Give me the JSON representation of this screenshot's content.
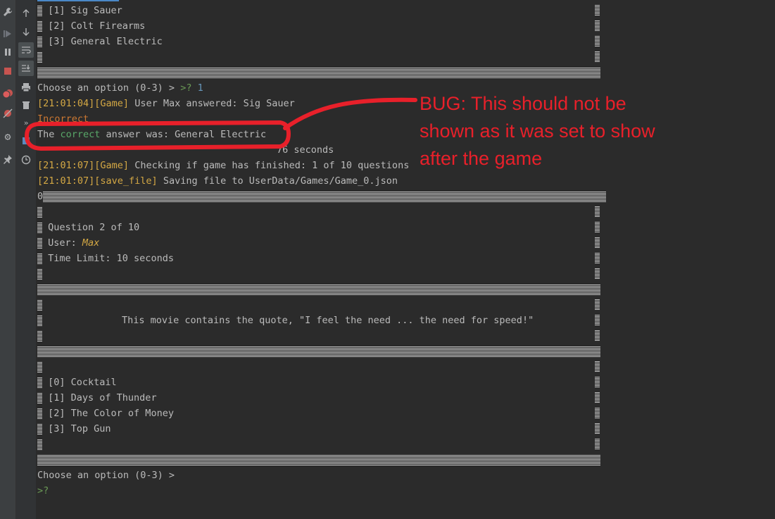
{
  "console": {
    "options_prev": [
      "[1] Sig Sauer",
      "[2] Colt Firearms",
      "[3] General Electric"
    ],
    "prompt": "Choose an option (0-3) > ",
    "input_marker": ">?",
    "input_value": " 1",
    "log1": {
      "ts": "[21:01:04]",
      "tag": "[Game]",
      "msg": " User Max answered: Sig Sauer"
    },
    "incorrect": "Incorrect",
    "correct_line": {
      "pre": "The ",
      "word": "correct",
      "post": " answer was: General Electric"
    },
    "time_line_suffix": "76 seconds",
    "log2": {
      "ts": "[21:01:07]",
      "tag": "[Game]",
      "msg": " Checking if game has finished: 1 of 10 questions"
    },
    "log3": {
      "ts": "[21:01:07]",
      "tag": "[save_file]",
      "msg": " Saving file to UserData/Games/Game_0.json"
    },
    "zero_marker": "0",
    "question_header": "Question 2 of 10",
    "user_label": "User: ",
    "user_name": "Max",
    "time_limit": "Time Limit: 10 seconds",
    "question_text": "This movie contains the quote, \"I feel the need ... the need for speed!\"",
    "options": [
      "[0] Cocktail",
      "[1] Days of Thunder",
      "[2] The Color of Money",
      "[3] Top Gun"
    ],
    "prompt2": "Choose an option (0-3) > ",
    "input_marker2": ">?"
  },
  "annotation": {
    "text_lines": [
      "BUG: This should not be",
      "shown as it was set to show",
      "after the game"
    ],
    "color": "#e8202a"
  },
  "icons": {
    "left_gutter": [
      "wrench-icon",
      "rerun-icon",
      "pause-icon",
      "stop-icon",
      "breakpoints-icon",
      "mute-breakpoints-icon",
      "settings-icon",
      "pin-icon"
    ],
    "tool_column": [
      "up-arrow-icon",
      "down-arrow-icon",
      "soft-wrap-icon",
      "scroll-to-end-icon",
      "print-icon",
      "trash-icon",
      "more-icon",
      "layout-icon",
      "clock-icon"
    ]
  }
}
